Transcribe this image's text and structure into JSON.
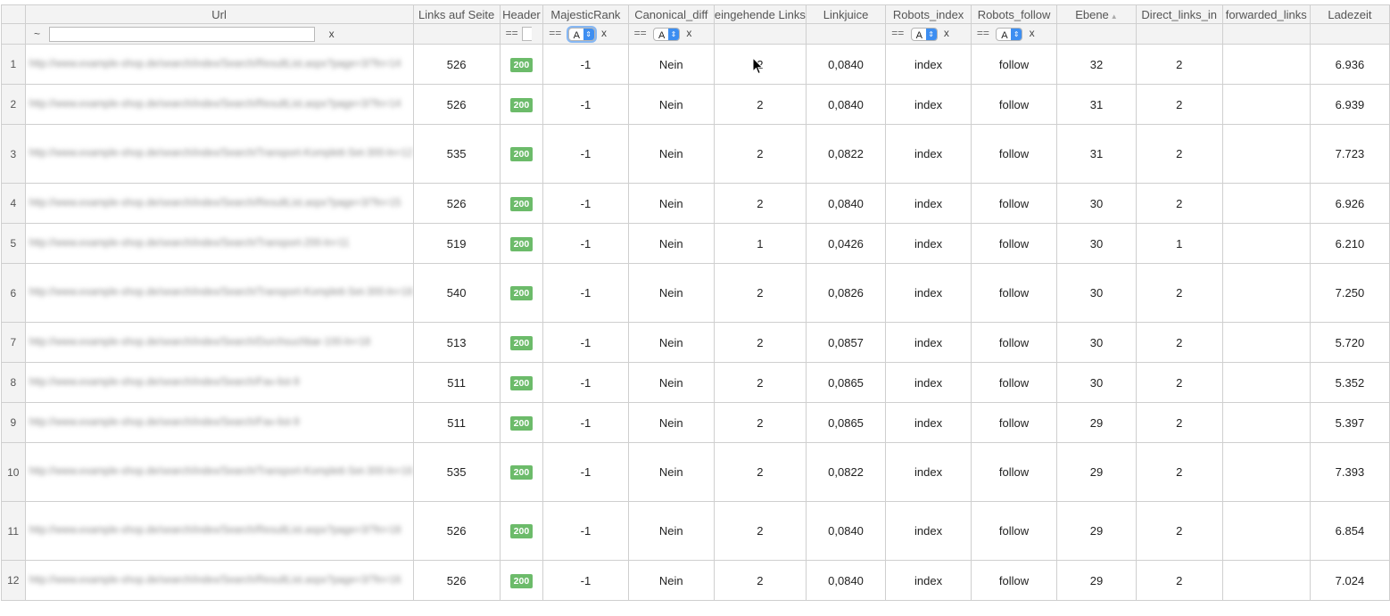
{
  "columns": {
    "url": "Url",
    "links": "Links auf Seite",
    "header": "Header",
    "majestic": "MajesticRank",
    "canonical": "Canonical_diff",
    "incoming": "eingehende Links",
    "linkjuice": "Linkjuice",
    "robots_index": "Robots_index",
    "robots_follow": "Robots_follow",
    "ebene": "Ebene",
    "direct_links": "Direct_links_in",
    "forwarded": "forwarded_links",
    "ladezeit": "Ladezeit"
  },
  "filters": {
    "url_prefix": "~",
    "url_clear": "x",
    "eq": "==",
    "select_value": "A",
    "clear": "x"
  },
  "rows": [
    {
      "n": "1",
      "url": "http://www.example-shop.de/search/index/Search/ResultList.aspx?page=3/?ln=14",
      "links": "526",
      "status": "200",
      "majestic": "-1",
      "canonical": "Nein",
      "incoming": "2",
      "linkjuice": "0,0840",
      "index": "index",
      "follow": "follow",
      "ebene": "32",
      "direct": "2",
      "forwarded": "",
      "ladezeit": "6.936"
    },
    {
      "n": "2",
      "url": "http://www.example-shop.de/search/index/Search/ResultList.aspx?page=3/?ln=14",
      "links": "526",
      "status": "200",
      "majestic": "-1",
      "canonical": "Nein",
      "incoming": "2",
      "linkjuice": "0,0840",
      "index": "index",
      "follow": "follow",
      "ebene": "31",
      "direct": "2",
      "forwarded": "",
      "ladezeit": "6.939"
    },
    {
      "n": "3",
      "url": "http://www.example-shop.de/search/index/Search/Transport-Komplett-Set-300-ln=12",
      "links": "535",
      "status": "200",
      "majestic": "-1",
      "canonical": "Nein",
      "incoming": "2",
      "linkjuice": "0,0822",
      "index": "index",
      "follow": "follow",
      "ebene": "31",
      "direct": "2",
      "forwarded": "",
      "ladezeit": "7.723"
    },
    {
      "n": "4",
      "url": "http://www.example-shop.de/search/index/Search/ResultList.aspx?page=3/?ln=15",
      "links": "526",
      "status": "200",
      "majestic": "-1",
      "canonical": "Nein",
      "incoming": "2",
      "linkjuice": "0,0840",
      "index": "index",
      "follow": "follow",
      "ebene": "30",
      "direct": "2",
      "forwarded": "",
      "ladezeit": "6.926"
    },
    {
      "n": "5",
      "url": "http://www.example-shop.de/search/index/Search/Transport-200-ln=11",
      "links": "519",
      "status": "200",
      "majestic": "-1",
      "canonical": "Nein",
      "incoming": "1",
      "linkjuice": "0,0426",
      "index": "index",
      "follow": "follow",
      "ebene": "30",
      "direct": "1",
      "forwarded": "",
      "ladezeit": "6.210"
    },
    {
      "n": "6",
      "url": "http://www.example-shop.de/search/index/Search/Transport-Komplett-Set-300-ln=18",
      "links": "540",
      "status": "200",
      "majestic": "-1",
      "canonical": "Nein",
      "incoming": "2",
      "linkjuice": "0,0826",
      "index": "index",
      "follow": "follow",
      "ebene": "30",
      "direct": "2",
      "forwarded": "",
      "ladezeit": "7.250"
    },
    {
      "n": "7",
      "url": "http://www.example-shop.de/search/index/Search/Durchsuchbar-100-ln=18",
      "links": "513",
      "status": "200",
      "majestic": "-1",
      "canonical": "Nein",
      "incoming": "2",
      "linkjuice": "0,0857",
      "index": "index",
      "follow": "follow",
      "ebene": "30",
      "direct": "2",
      "forwarded": "",
      "ladezeit": "5.720"
    },
    {
      "n": "8",
      "url": "http://www.example-shop.de/search/index/Search/Fav-list-9",
      "links": "511",
      "status": "200",
      "majestic": "-1",
      "canonical": "Nein",
      "incoming": "2",
      "linkjuice": "0,0865",
      "index": "index",
      "follow": "follow",
      "ebene": "30",
      "direct": "2",
      "forwarded": "",
      "ladezeit": "5.352"
    },
    {
      "n": "9",
      "url": "http://www.example-shop.de/search/index/Search/Fav-list-9",
      "links": "511",
      "status": "200",
      "majestic": "-1",
      "canonical": "Nein",
      "incoming": "2",
      "linkjuice": "0,0865",
      "index": "index",
      "follow": "follow",
      "ebene": "29",
      "direct": "2",
      "forwarded": "",
      "ladezeit": "5.397"
    },
    {
      "n": "10",
      "url": "http://www.example-shop.de/search/index/Search/Transport-Komplett-Set-300-ln=16",
      "links": "535",
      "status": "200",
      "majestic": "-1",
      "canonical": "Nein",
      "incoming": "2",
      "linkjuice": "0,0822",
      "index": "index",
      "follow": "follow",
      "ebene": "29",
      "direct": "2",
      "forwarded": "",
      "ladezeit": "7.393"
    },
    {
      "n": "11",
      "url": "http://www.example-shop.de/search/index/Search/ResultList.aspx?page=3/?ln=18",
      "links": "526",
      "status": "200",
      "majestic": "-1",
      "canonical": "Nein",
      "incoming": "2",
      "linkjuice": "0,0840",
      "index": "index",
      "follow": "follow",
      "ebene": "29",
      "direct": "2",
      "forwarded": "",
      "ladezeit": "6.854"
    },
    {
      "n": "12",
      "url": "http://www.example-shop.de/search/index/Search/ResultList.aspx?page=3/?ln=16",
      "links": "526",
      "status": "200",
      "majestic": "-1",
      "canonical": "Nein",
      "incoming": "2",
      "linkjuice": "0,0840",
      "index": "index",
      "follow": "follow",
      "ebene": "29",
      "direct": "2",
      "forwarded": "",
      "ladezeit": "7.024"
    }
  ],
  "colors": {
    "status_ok": "#6cbb6a",
    "select_accent": "#3d8ef1",
    "header_bg": "#f3f3f3"
  }
}
